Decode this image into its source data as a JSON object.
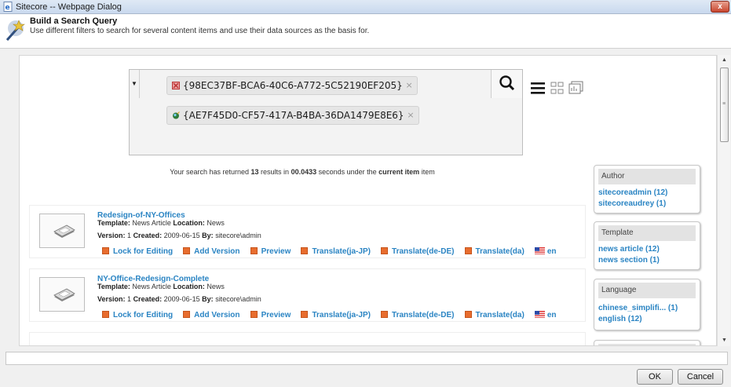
{
  "window": {
    "title": "Sitecore -- Webpage Dialog",
    "close_label": "x"
  },
  "header": {
    "title": "Build a Search Query",
    "subtitle": "Use different filters to search for several content items and use their data sources as the basis for."
  },
  "search": {
    "tags": [
      {
        "text": "{98EC37BF-BCA6-40C6-A772-5C52190EF205}",
        "remove": "×"
      },
      {
        "text": "{AE7F45D0-CF57-417A-B4BA-36DA1479E8E6}",
        "remove": "×"
      }
    ]
  },
  "summary": {
    "prefix": "Your search has returned ",
    "count": "13",
    "mid1": " results in ",
    "time": "00.0433",
    "mid2": " seconds under the ",
    "scope": "current item",
    "suffix": " item"
  },
  "results": [
    {
      "title": "Redesign-of-NY-Offices",
      "template_label": "Template:",
      "template": "News Article",
      "location_label": "Location:",
      "location": "News",
      "version_label": "Version:",
      "version": "1",
      "created_label": "Created:",
      "created": "2009-06-15",
      "by_label": "By:",
      "by": "sitecore\\admin"
    },
    {
      "title": "NY-Office-Redesign-Complete",
      "template_label": "Template:",
      "template": "News Article",
      "location_label": "Location:",
      "location": "News",
      "version_label": "Version:",
      "version": "1",
      "created_label": "Created:",
      "created": "2009-06-15",
      "by_label": "By:",
      "by": "sitecore\\admin"
    }
  ],
  "actions": {
    "lock": "Lock for Editing",
    "add_version": "Add Version",
    "preview": "Preview",
    "translate_ja": "Translate(ja-JP)",
    "translate_de": "Translate(de-DE)",
    "translate_da": "Translate(da)",
    "lang": "en"
  },
  "facets": [
    {
      "heading": "Author",
      "items": [
        "sitecoreadmin (12)",
        "sitecoreaudrey (1)"
      ]
    },
    {
      "heading": "Template",
      "items": [
        "news article (12)",
        "news section (1)"
      ]
    },
    {
      "heading": "Language",
      "items": [
        "chinese_simplifi... (1)",
        "english (12)"
      ]
    }
  ],
  "footer": {
    "ok": "OK",
    "cancel": "Cancel"
  },
  "colors": {
    "link": "#2a84c3",
    "action_icon": "#e86d2e",
    "titlebar": "#c9d9ee"
  }
}
